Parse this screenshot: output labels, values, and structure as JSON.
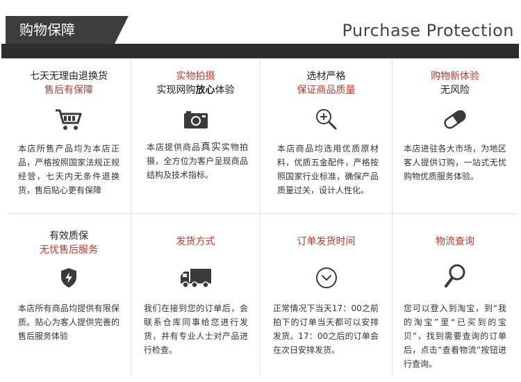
{
  "header": {
    "title_cn": "购物保障",
    "title_en": "Purchase Protection"
  },
  "colors": {
    "accent_red": "#c0392b",
    "header_dark": "#3d3d3d",
    "icon_dark": "#3a3a3a"
  },
  "items": [
    {
      "icon": "shopping-cart-icon",
      "line1": "七天无理由退换货",
      "line2": "售后有保障",
      "desc": "本店所售产品均为本店正品，严格按照国家法规正规经营，七天内无条件退换货，售后贴心更有保障"
    },
    {
      "icon": "camera-icon",
      "line1": "实物拍摄",
      "line2_a": "实现网购",
      "line2_b": "放心",
      "line2_c": "体验",
      "desc_a": "本店提供商品",
      "desc_hl": "真实",
      "desc_b": "实物拍摄，全方位为客户呈现商品结构及技术指标。"
    },
    {
      "icon": "magnifier-plus-icon",
      "line1": "选材严格",
      "line2": "保证商品质量",
      "desc": "本店商品均选用优质原材料，优质五金配件，严格按照国家行业标准，确保产品质量过关，设计人性化。"
    },
    {
      "icon": "pill-capsule-icon",
      "line1": "购物新体验",
      "line2": "无风险",
      "desc": "本店进驻各大市场，为地区客人提供订购，一站式无忧购物优质服务体验。"
    },
    {
      "icon": "shield-lightning-icon",
      "line1": "有效质保",
      "line2": "无忧售后服务",
      "desc": "本店所有商品均提供有限保质。贴心为客人提供完善的售后服务体验"
    },
    {
      "icon": "delivery-truck-icon",
      "line1": "发货方式",
      "desc": "我们在接到您的订单后，会联系仓库同事给您进行发货，并有专业人士对产品进行检查。"
    },
    {
      "icon": "clock-icon",
      "line1": "订单发货时间",
      "desc": "正常情况下当天17：00之前拍下的订单当天都可以安排发货。17：00之后的订单会在次日安排发货。"
    },
    {
      "icon": "search-icon",
      "line1": "物流查询",
      "desc": "您可以登入到淘宝，到“我的淘宝”里“已买到的宝贝”，找到需要查询的订单后，点击“查看物流”按钮进行查询。"
    }
  ]
}
